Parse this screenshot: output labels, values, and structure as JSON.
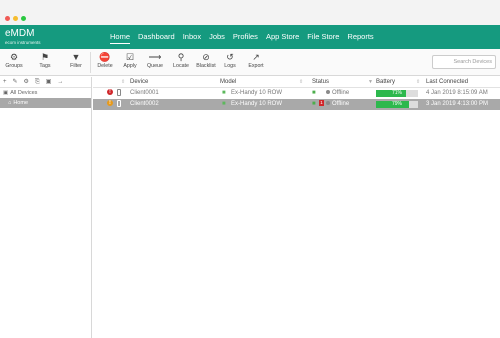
{
  "colors": {
    "accent": "#159a7f",
    "close": "#f05a55",
    "minimize": "#f6bd2f",
    "zoom": "#2ac840",
    "battery": "#2db84d",
    "selected_row": "#a9a9a9"
  },
  "app": {
    "title": "eMDM",
    "subtitle": "ecom instruments"
  },
  "nav": [
    {
      "label": "Home",
      "active": true
    },
    {
      "label": "Dashboard"
    },
    {
      "label": "Inbox"
    },
    {
      "label": "Jobs"
    },
    {
      "label": "Profiles"
    },
    {
      "label": "App Store"
    },
    {
      "label": "File Store"
    },
    {
      "label": "Reports"
    }
  ],
  "toolbar": {
    "left": [
      {
        "label": "Groups",
        "icon": "groups-icon"
      },
      {
        "label": "Tags",
        "icon": "tag-icon"
      },
      {
        "label": "Filter",
        "icon": "filter-icon"
      }
    ],
    "actions": [
      {
        "label": "Delete",
        "icon": "delete-icon"
      },
      {
        "label": "Apply",
        "icon": "checkbox-icon"
      },
      {
        "label": "Queue",
        "icon": "arrow-right-icon"
      },
      {
        "label": "Locate",
        "icon": "location-pin-icon"
      },
      {
        "label": "Blacklist",
        "icon": "blacklist-icon"
      },
      {
        "label": "Logs",
        "icon": "logs-icon"
      },
      {
        "label": "Export",
        "icon": "export-icon"
      }
    ],
    "search_placeholder": "Search Devices"
  },
  "sidebar": {
    "tools": [
      "+",
      "✎",
      "⚙",
      "⎘",
      "▣",
      "→"
    ],
    "items": [
      {
        "label": "All Devices",
        "icon": "devices-icon"
      },
      {
        "label": "Home",
        "icon": "home-icon",
        "selected": true
      }
    ]
  },
  "table": {
    "columns": [
      "Device",
      "Model",
      "Status",
      "Battery",
      "Last Connected"
    ],
    "rows": [
      {
        "alert": "!",
        "alert_color": "red",
        "device": "Client0001",
        "model": "Ex-Handy 10 ROW",
        "status": "Offline",
        "status_alert": "",
        "battery": 71,
        "battery_text": "71%",
        "last_connected": "4 Jan 2019 8:15:09 AM",
        "selected": false
      },
      {
        "alert": "!",
        "alert_color": "orange",
        "device": "Client0002",
        "model": "Ex-Handy 10 ROW",
        "status": "Offline",
        "status_alert": "1",
        "battery": 79,
        "battery_text": "79%",
        "last_connected": "3 Jan 2019 4:13:00 PM",
        "selected": true
      }
    ]
  }
}
